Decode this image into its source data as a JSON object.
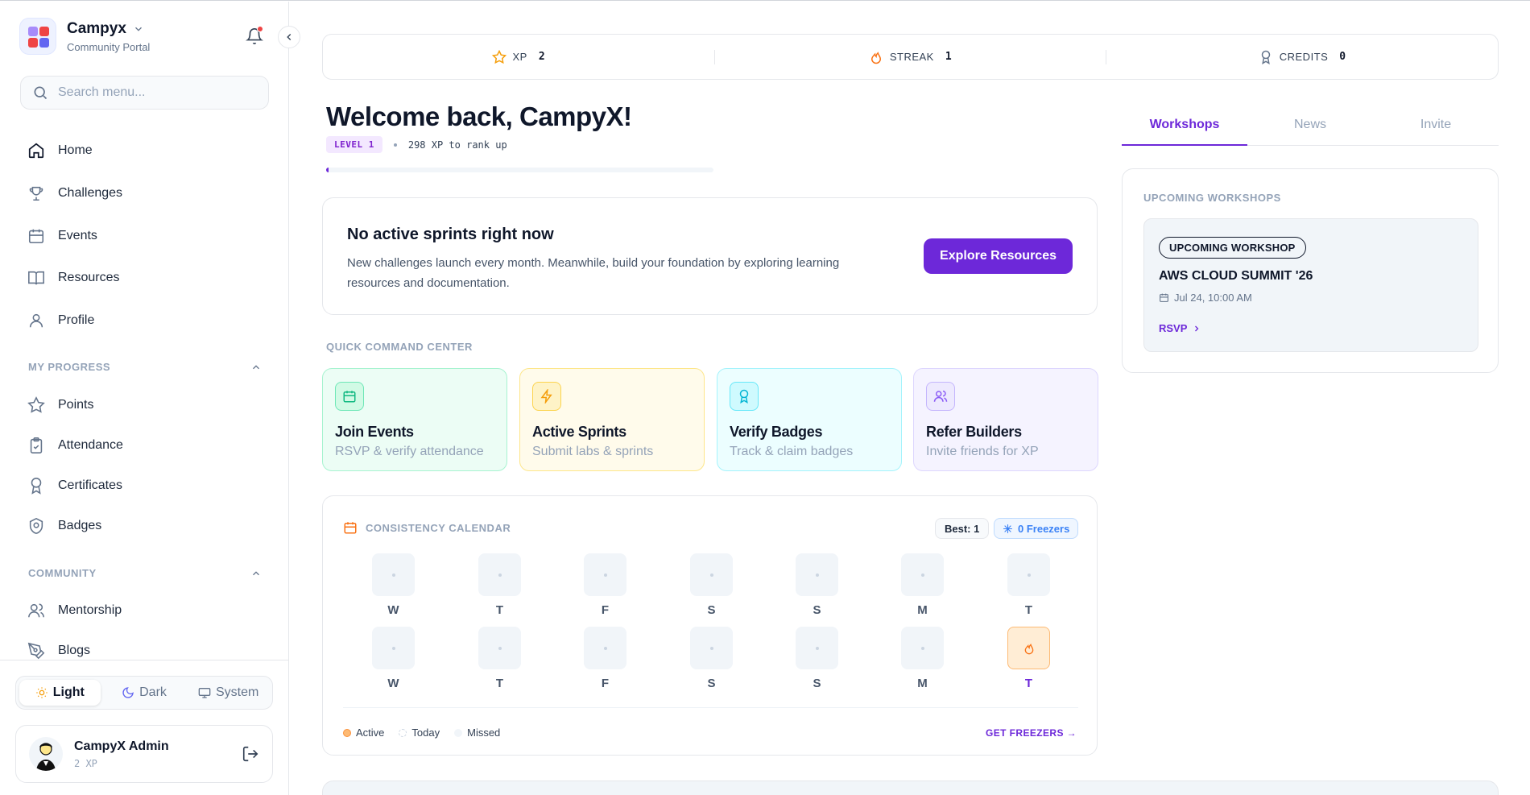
{
  "brand": {
    "name": "Campyx",
    "subtitle": "Community Portal"
  },
  "search": {
    "placeholder": "Search menu..."
  },
  "nav": {
    "main": [
      {
        "label": "Home",
        "icon": "home-icon"
      },
      {
        "label": "Challenges",
        "icon": "trophy-icon"
      },
      {
        "label": "Events",
        "icon": "calendar-icon"
      },
      {
        "label": "Resources",
        "icon": "book-icon"
      },
      {
        "label": "Profile",
        "icon": "user-icon"
      }
    ],
    "progress_section": "MY PROGRESS",
    "progress": [
      {
        "label": "Points",
        "icon": "star-icon"
      },
      {
        "label": "Attendance",
        "icon": "clipboard-check-icon"
      },
      {
        "label": "Certificates",
        "icon": "award-icon"
      },
      {
        "label": "Badges",
        "icon": "badge-icon"
      }
    ],
    "community_section": "COMMUNITY",
    "community": [
      {
        "label": "Mentorship",
        "icon": "users-icon"
      },
      {
        "label": "Blogs",
        "icon": "pen-icon"
      }
    ]
  },
  "theme": {
    "light": "Light",
    "dark": "Dark",
    "system": "System",
    "selected": "Light"
  },
  "user": {
    "name": "CampyX Admin",
    "xp": "2 XP"
  },
  "stats": {
    "xp_label": "XP",
    "xp_value": "2",
    "streak_label": "STREAK",
    "streak_value": "1",
    "credits_label": "CREDITS",
    "credits_value": "0"
  },
  "welcome": {
    "title": "Welcome back, CampyX!",
    "level": "LEVEL 1",
    "rank_text": "298 XP to rank up",
    "progress_fraction": 0.006
  },
  "sprint": {
    "title": "No active sprints right now",
    "desc": "New challenges launch every month. Meanwhile, build your foundation by exploring learning resources and documentation.",
    "button": "Explore Resources"
  },
  "quick": {
    "label": "QUICK COMMAND CENTER",
    "cards": [
      {
        "title": "Join Events",
        "sub": "RSVP & verify attendance",
        "icon": "calendar-icon"
      },
      {
        "title": "Active Sprints",
        "sub": "Submit labs & sprints",
        "icon": "bolt-icon"
      },
      {
        "title": "Verify Badges",
        "sub": "Track & claim badges",
        "icon": "award-icon"
      },
      {
        "title": "Refer Builders",
        "sub": "Invite friends for XP",
        "icon": "users-icon"
      }
    ]
  },
  "calendar": {
    "title": "CONSISTENCY CALENDAR",
    "best": "Best: 1",
    "freezers": "0 Freezers",
    "row1": [
      "W",
      "T",
      "F",
      "S",
      "S",
      "M",
      "T"
    ],
    "row2": [
      "W",
      "T",
      "F",
      "S",
      "S",
      "M",
      "T"
    ],
    "legend_active": "Active",
    "legend_today": "Today",
    "legend_missed": "Missed",
    "get_freezers": "GET FREEZERS →"
  },
  "tabs": [
    "Workshops",
    "News",
    "Invite"
  ],
  "workshops": {
    "label": "UPCOMING WORKSHOPS",
    "pill": "UPCOMING WORKSHOP",
    "title": "AWS CLOUD SUMMIT '26",
    "date": "Jul 24, 10:00 AM",
    "rsvp": "RSVP"
  },
  "colors": {
    "accent": "#6d28d9",
    "streak": "#f97316",
    "freeze": "#3b82f6"
  }
}
